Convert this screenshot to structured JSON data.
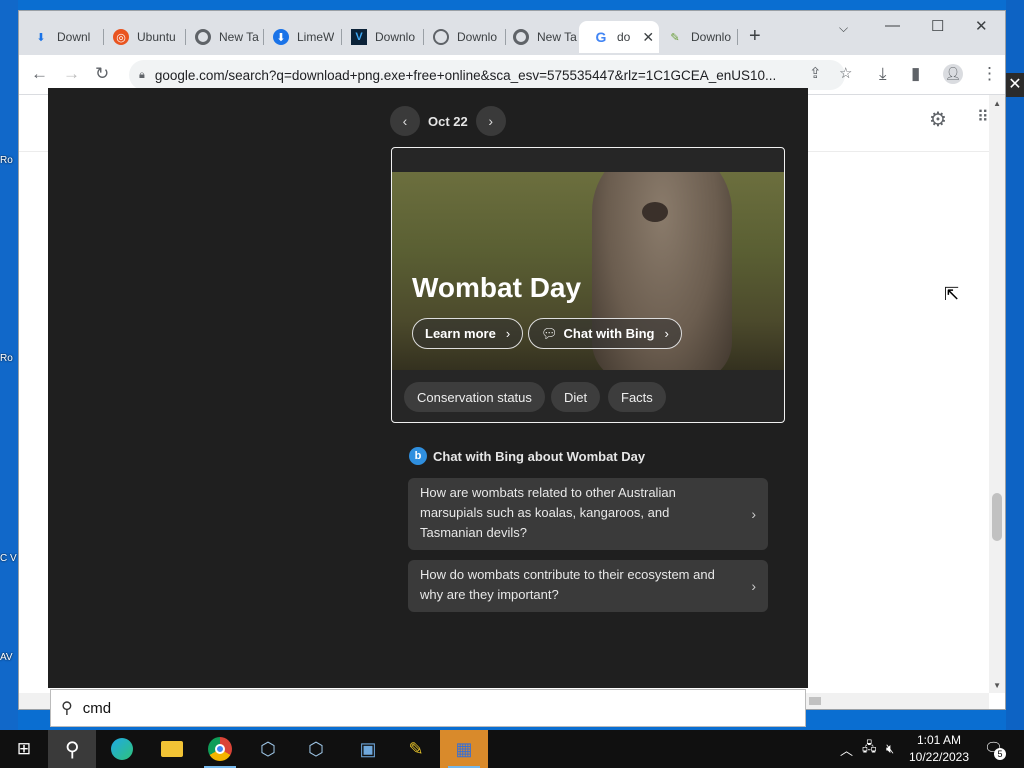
{
  "desktop": {
    "icons": [
      "Ro",
      "Ro",
      "C V",
      "AV"
    ]
  },
  "browser": {
    "tabs": [
      {
        "title": "Downl",
        "icon": "download-icon"
      },
      {
        "title": "Ubuntu",
        "icon": "ubuntu-icon"
      },
      {
        "title": "New Ta",
        "icon": "chrome-icon"
      },
      {
        "title": "LimeW",
        "icon": "globe-icon"
      },
      {
        "title": "Downlo",
        "icon": "v-logo-icon"
      },
      {
        "title": "Downlo",
        "icon": "globe-icon"
      },
      {
        "title": "New Ta",
        "icon": "chrome-icon"
      },
      {
        "title": "do",
        "icon": "google-icon",
        "active": true
      },
      {
        "title": "Downlo",
        "icon": "feather-icon"
      }
    ],
    "url": "google.com/search?q=download+png.exe+free+online&sca_esv=575535447&rlz=1C1GCEA_enUS10..."
  },
  "flyout": {
    "date": "Oct 22",
    "card": {
      "title": "Wombat Day",
      "learn_more": "Learn more",
      "chat_with_bing": "Chat with Bing",
      "chips": [
        "Conservation status",
        "Diet",
        "Facts"
      ]
    },
    "chat": {
      "header": "Chat with Bing about Wombat Day",
      "questions": [
        "How are wombats related to other Australian marsupials such as koalas, kangaroos, and Tasmanian devils?",
        "How do wombats contribute to their ecosystem and why are they important?"
      ]
    },
    "search": {
      "value": "cmd"
    }
  },
  "taskbar": {
    "time": "1:01 AM",
    "date": "10/22/2023",
    "notifications": "5"
  },
  "colors": {
    "flyout_bg": "#1f1f1f",
    "taskbar_bg": "#101010",
    "desktop_bg": "#0a6ed1"
  }
}
